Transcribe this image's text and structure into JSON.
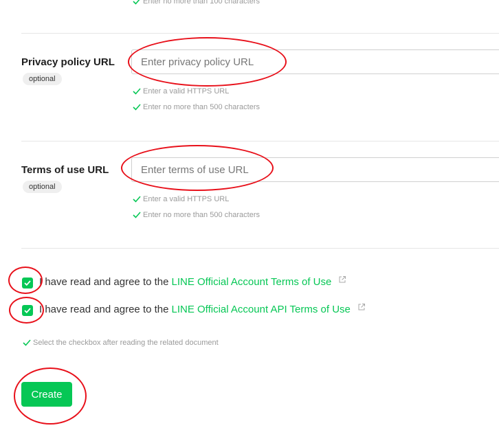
{
  "top_hint": "Enter no more than 100 characters",
  "privacy": {
    "label": "Privacy policy URL",
    "badge": "optional",
    "placeholder": "Enter privacy policy URL",
    "hints": [
      "Enter a valid HTTPS URL",
      "Enter no more than 500 characters"
    ]
  },
  "terms": {
    "label": "Terms of use URL",
    "badge": "optional",
    "placeholder": "Enter terms of use URL",
    "hints": [
      "Enter a valid HTTPS URL",
      "Enter no more than 500 characters"
    ]
  },
  "agreements": [
    {
      "prefix": "I have read and agree to the",
      "link": "LINE Official Account Terms of Use",
      "checked": true
    },
    {
      "prefix": "I have read and agree to the",
      "link": "LINE Official Account API Terms of Use",
      "checked": true
    }
  ],
  "agreement_hint": "Select the checkbox after reading the related document",
  "create_label": "Create",
  "colors": {
    "accent": "#06c755",
    "annotation": "#e8101a"
  },
  "icons": [
    "check-icon",
    "external-link-icon"
  ]
}
